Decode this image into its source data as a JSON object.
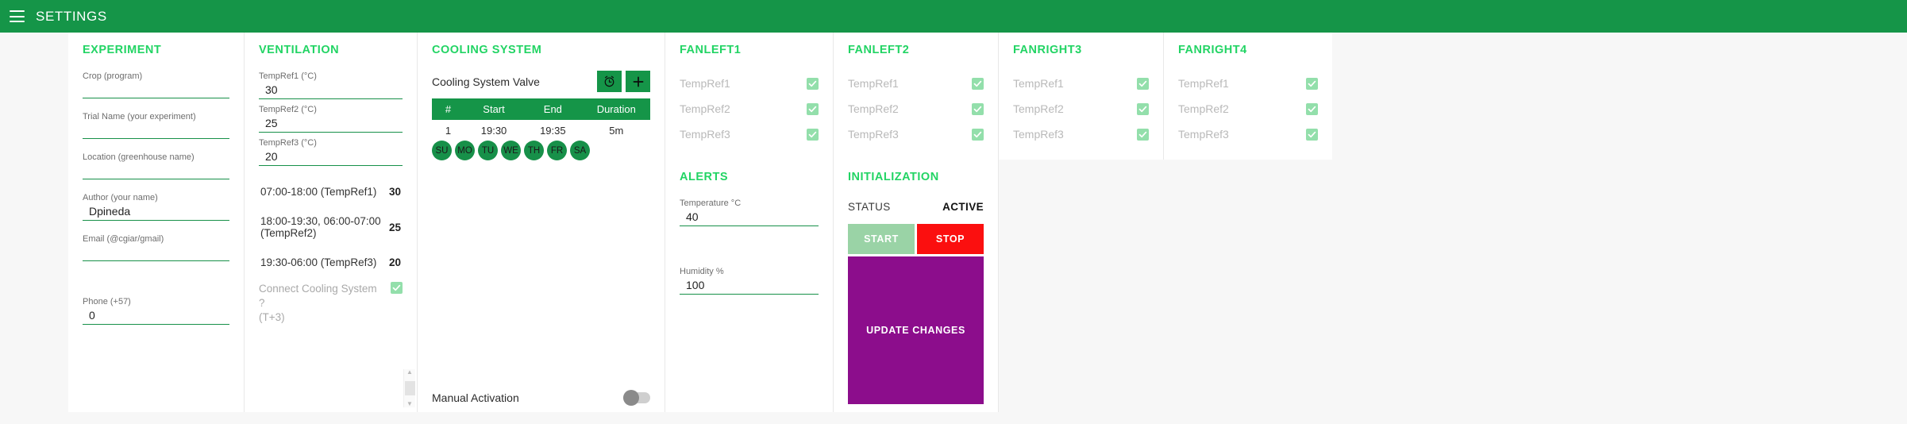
{
  "header": {
    "title": "SETTINGS",
    "menu_icon": "hamburger-menu-icon",
    "bg": "#159548"
  },
  "experiment": {
    "title": "EXPERIMENT",
    "fields": [
      {
        "label": "Crop (program)",
        "value": ""
      },
      {
        "label": "Trial Name (your experiment)",
        "value": ""
      },
      {
        "label": "Location (greenhouse name)",
        "value": ""
      },
      {
        "label": "Author (your name)",
        "value": "Dpineda"
      },
      {
        "label": "Email (@cgiar/gmail)",
        "value": ""
      },
      {
        "label": "Phone (+57)",
        "value": "0"
      }
    ]
  },
  "ventilation": {
    "title": "VENTILATION",
    "fields": [
      {
        "label": "TempRef1 (°C)",
        "value": "30"
      },
      {
        "label": "TempRef2 (°C)",
        "value": "25"
      },
      {
        "label": "TempRef3 (°C)",
        "value": "20"
      }
    ],
    "schedule": [
      {
        "range": "07:00-18:00 (TempRef1)",
        "value": "30"
      },
      {
        "range": "18:00-19:30, 06:00-07:00 (TempRef2)",
        "value": "25"
      },
      {
        "range": "19:30-06:00 (TempRef3)",
        "value": "20"
      }
    ],
    "connect": {
      "label_line1": "Connect Cooling System ?",
      "label_line2": "(T+3)",
      "checked": true
    }
  },
  "cooling": {
    "title": "COOLING SYSTEM",
    "valve_label": "Cooling System Valve",
    "alarm_icon": "alarm-clock-icon",
    "add_icon": "plus-icon",
    "columns": [
      "#",
      "Start",
      "End",
      "Duration"
    ],
    "rows": [
      {
        "num": "1",
        "start": "19:30",
        "end": "19:35",
        "duration": "5m"
      }
    ],
    "days": [
      "SU",
      "MO",
      "TU",
      "WE",
      "TH",
      "FR",
      "SA"
    ],
    "manual_label": "Manual Activation",
    "manual_on": false
  },
  "fans": [
    {
      "title": "FANLEFT1",
      "refs": [
        "TempRef1",
        "TempRef2",
        "TempRef3"
      ],
      "checked": [
        true,
        true,
        true
      ]
    },
    {
      "title": "FANLEFT2",
      "refs": [
        "TempRef1",
        "TempRef2",
        "TempRef3"
      ],
      "checked": [
        true,
        true,
        true
      ]
    },
    {
      "title": "FANRIGHT3",
      "refs": [
        "TempRef1",
        "TempRef2",
        "TempRef3"
      ],
      "checked": [
        true,
        true,
        true
      ]
    },
    {
      "title": "FANRIGHT4",
      "refs": [
        "TempRef1",
        "TempRef2",
        "TempRef3"
      ],
      "checked": [
        true,
        true,
        true
      ]
    }
  ],
  "alerts": {
    "title": "ALERTS",
    "fields": [
      {
        "label": "Temperature °C",
        "value": "40"
      },
      {
        "label": "Humidity %",
        "value": "100"
      }
    ]
  },
  "initialization": {
    "title": "INITIALIZATION",
    "status_label": "STATUS",
    "status_value": "ACTIVE",
    "start_label": "START",
    "stop_label": "STOP",
    "update_label": "UPDATE CHANGES",
    "colors": {
      "start": "#9ad3a6",
      "stop": "#fb0f0f",
      "update": "#8c0d8c",
      "accent": "#22d464"
    }
  }
}
